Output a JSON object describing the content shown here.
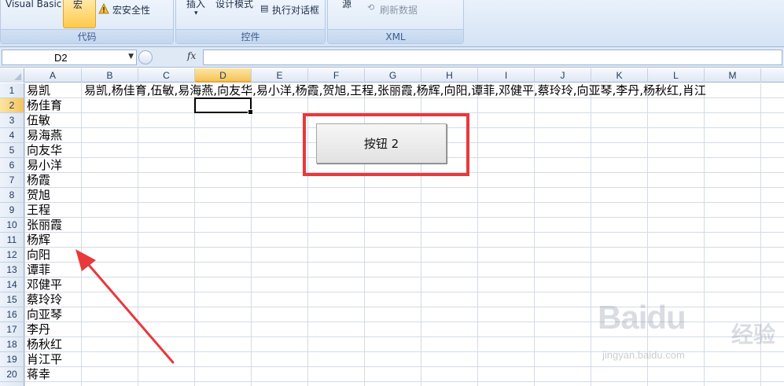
{
  "ribbon": {
    "groups": [
      {
        "title": "代码",
        "items": [
          "Visual Basic",
          "宏",
          "宏安全性"
        ]
      },
      {
        "title": "控件",
        "items": [
          "插入",
          "设计模式",
          "执行对话框"
        ]
      },
      {
        "title": "XML",
        "items": [
          "源",
          "刷新数据"
        ]
      }
    ]
  },
  "formula_bar": {
    "name_box": "D2",
    "fx_label": "fx",
    "formula": ""
  },
  "sheet": {
    "columns": [
      "A",
      "B",
      "C",
      "D",
      "E",
      "F",
      "G",
      "H",
      "I",
      "J",
      "K",
      "L",
      "M"
    ],
    "rows": [
      "1",
      "2",
      "3",
      "4",
      "5",
      "6",
      "7",
      "8",
      "9",
      "10",
      "11",
      "12",
      "13",
      "14",
      "15",
      "16",
      "17",
      "18",
      "19",
      "20"
    ],
    "selected_column": "D",
    "selected_row": "2",
    "column_a": [
      "易凯",
      "杨佳育",
      "伍敏",
      "易海燕",
      "向友华",
      "易小洋",
      "杨霞",
      "贺旭",
      "王程",
      "张丽霞",
      "杨辉",
      "向阳",
      "谭菲",
      "邓健平",
      "蔡玲玲",
      "向亚琴",
      "李丹",
      "杨秋红",
      "肖江平",
      "蒋幸"
    ],
    "b1_text": "易凯,杨佳育,伍敏,易海燕,向友华,易小洋,杨霞,贺旭,王程,张丽霞,杨辉,向阳,谭菲,邓健平,蔡玲玲,向亚琴,李丹,杨秋红,肖江"
  },
  "form_button": {
    "label": "按钮 2"
  },
  "watermark": {
    "brand": "Baidu",
    "brand_cn": "经验",
    "url": "jingyan.baidu.com"
  },
  "colors": {
    "highlight": "#e8393b",
    "selected_header": "#f5c45a"
  }
}
